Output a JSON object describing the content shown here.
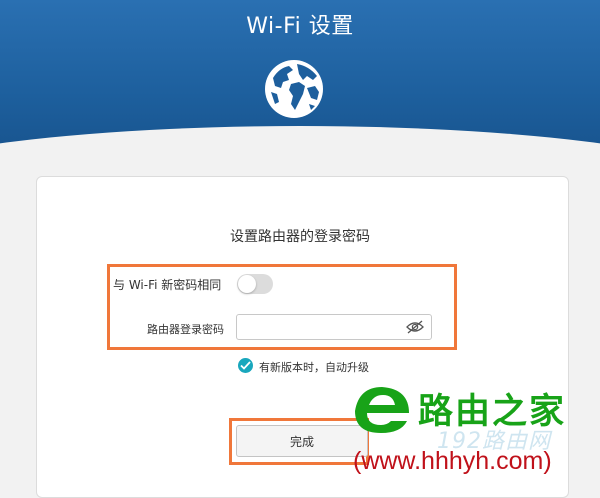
{
  "header": {
    "title": "Wi-Fi 设置",
    "icon": "globe-icon"
  },
  "card": {
    "title": "设置路由器的登录密码",
    "same_as_wifi": {
      "label": "与 Wi-Fi 新密码相同",
      "on": false
    },
    "password": {
      "label": "路由器登录密码",
      "value": "",
      "placeholder": "",
      "icon": "eye-hidden-icon"
    },
    "auto_upgrade": {
      "label": "有新版本时，自动升级",
      "checked": true
    },
    "finish_label": "完成"
  },
  "watermark": {
    "name": "路由之家",
    "ghost_text": "192路由网",
    "url": "(www.hhhyh.com)"
  },
  "colors": {
    "header_blue": "#1d5f9d",
    "highlight_orange": "#f0773a",
    "check_teal": "#19a7bd",
    "watermark_green": "#18a318",
    "watermark_red": "#c0111a"
  }
}
